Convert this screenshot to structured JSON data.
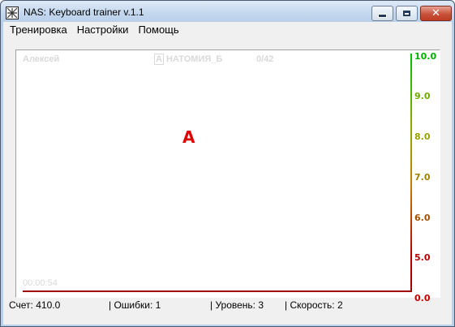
{
  "window": {
    "title": "NAS:  Keyboard trainer v.1.1",
    "icon": "app-keyboard-icon",
    "close_symbol": "✕"
  },
  "menu": {
    "items": [
      "Тренировка",
      "Настройки",
      "Помощь"
    ]
  },
  "trainer": {
    "user": "Алексей",
    "course_marker": "А",
    "course": "НАТОМИЯ_Б",
    "progress": "0/42",
    "timer": "00:00:54",
    "target_letter": "А",
    "baseline_color": "#a00000"
  },
  "speed_scale": {
    "labels": [
      "10.0",
      "9.0",
      "8.0",
      "7.0",
      "6.0",
      "5.0",
      "0.0"
    ],
    "colors": [
      "#00b000",
      "#70a800",
      "#9aa000",
      "#a08000",
      "#a05000",
      "#b00000",
      "#c00000"
    ]
  },
  "status": {
    "score": "Счет: 410.0",
    "errors": "| Ошибки: 1",
    "level": "| Уровень: 3",
    "speed": "| Скорость: 2"
  }
}
